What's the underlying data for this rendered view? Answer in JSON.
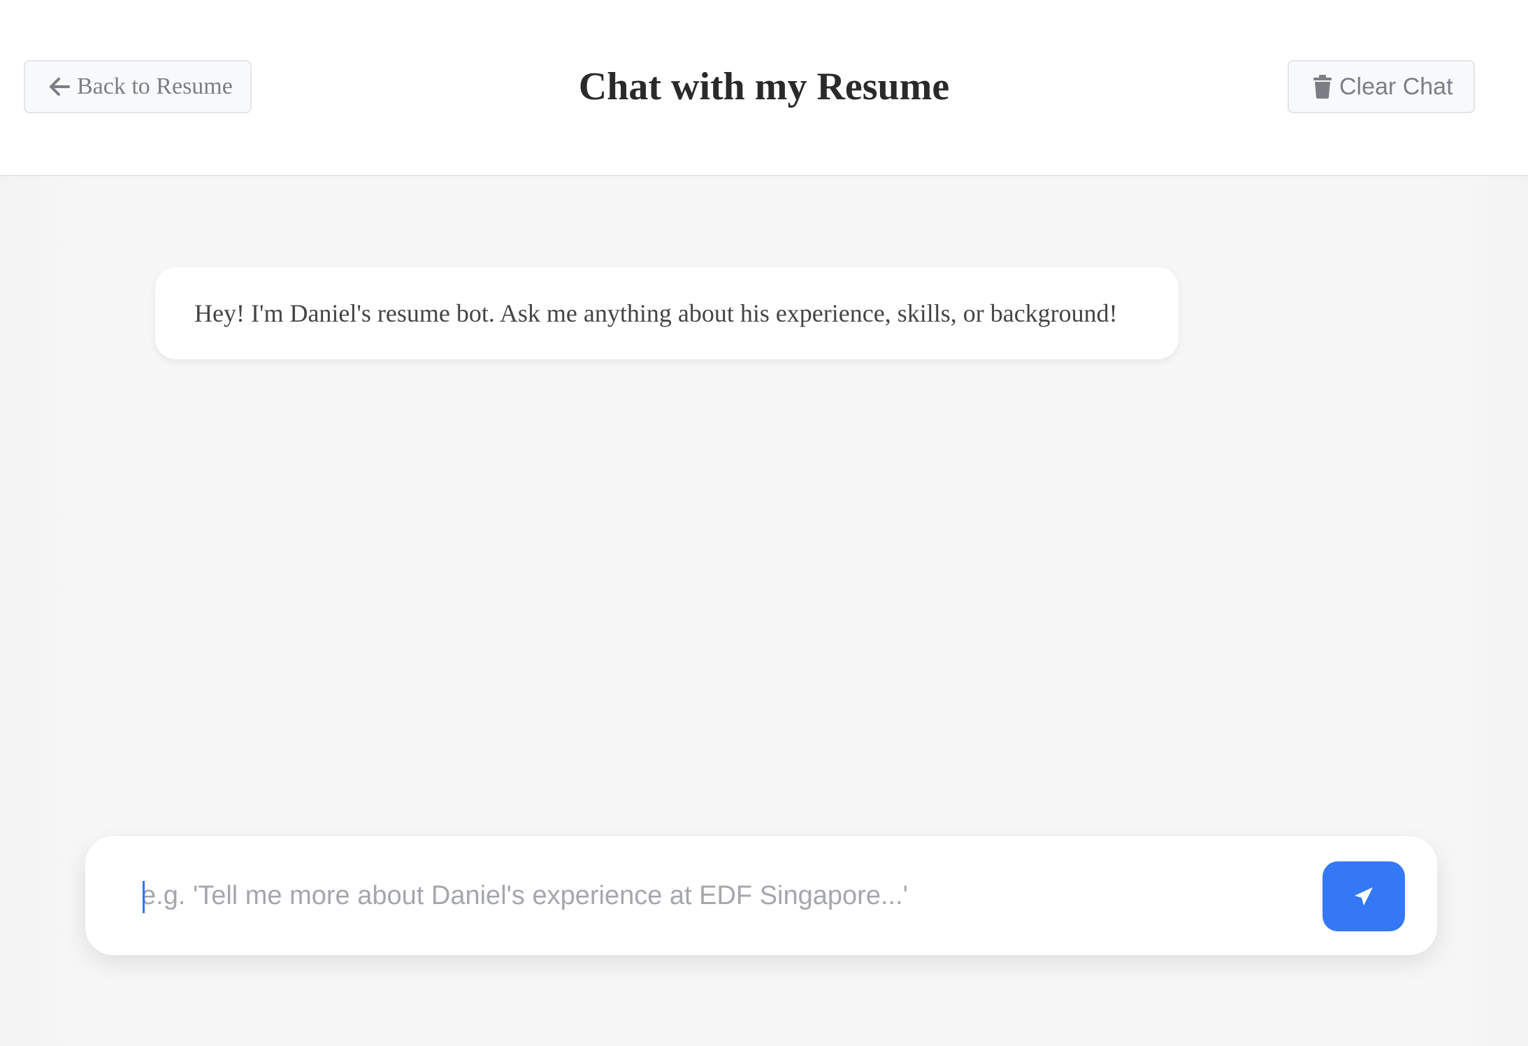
{
  "header": {
    "title": "Chat with my Resume",
    "back_label": "Back to Resume",
    "clear_label": "Clear Chat"
  },
  "messages": [
    {
      "role": "bot",
      "text": "Hey! I'm Daniel's resume bot. Ask me anything about his experience, skills, or background!"
    }
  ],
  "composer": {
    "placeholder": "e.g. 'Tell me more about Daniel's experience at EDF Singapore...'",
    "value": ""
  },
  "icons": {
    "back": "arrow-left-icon",
    "clear": "trash-icon",
    "send": "paper-plane-icon"
  },
  "colors": {
    "accent": "#3478f6",
    "caret": "#2f74f0"
  }
}
